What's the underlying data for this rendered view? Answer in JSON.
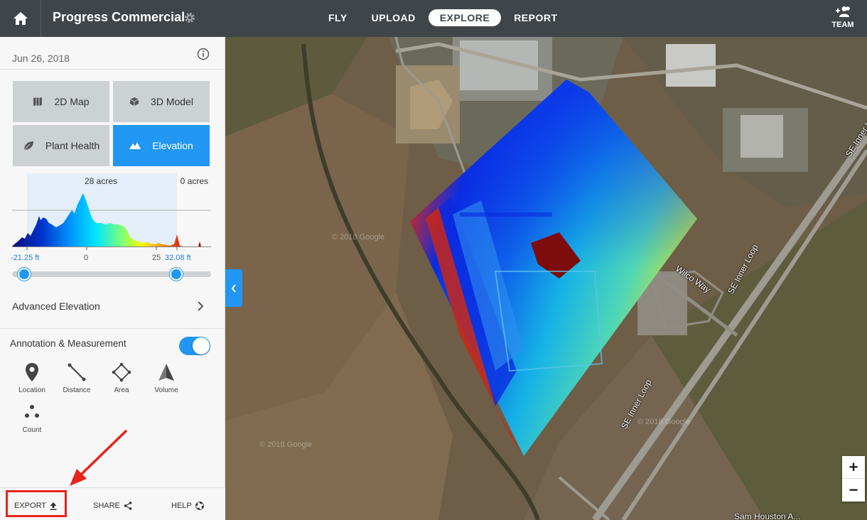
{
  "header": {
    "project_title": "Progress Commercial",
    "nav": [
      {
        "label": "FLY",
        "active": false
      },
      {
        "label": "UPLOAD",
        "active": false
      },
      {
        "label": "EXPLORE",
        "active": true
      },
      {
        "label": "REPORT",
        "active": false
      }
    ],
    "team_label": "TEAM"
  },
  "sidebar": {
    "date": "Jun 26, 2018",
    "layers": [
      {
        "label": "2D Map",
        "icon": "map-icon",
        "active": false
      },
      {
        "label": "3D Model",
        "icon": "cube-icon",
        "active": false
      },
      {
        "label": "Plant Health",
        "icon": "leaf-icon",
        "active": false
      },
      {
        "label": "Elevation",
        "icon": "mountain-icon",
        "active": true
      }
    ],
    "histogram": {
      "left_acres": "28 acres",
      "right_acres": "0 acres",
      "min_label": "-21.25 ft",
      "zero_label": "0",
      "mid_label": "25",
      "max_label": "32.08 ft",
      "range_low_ft": -21.25,
      "range_high_ft": 32.08
    },
    "advanced_elevation_label": "Advanced Elevation",
    "annotation_title": "Annotation & Measurement",
    "annotation_enabled": true,
    "tools": [
      {
        "label": "Location",
        "icon": "location-pin-icon"
      },
      {
        "label": "Distance",
        "icon": "distance-line-icon"
      },
      {
        "label": "Area",
        "icon": "area-polygon-icon"
      },
      {
        "label": "Volume",
        "icon": "volume-icon"
      },
      {
        "label": "Count",
        "icon": "count-dots-icon"
      }
    ],
    "bottom": {
      "export": "EXPORT",
      "share": "SHARE",
      "help": "HELP"
    }
  },
  "map": {
    "roads": [
      "SE Inner Loop",
      "SE Inner Loop",
      "SE Inner Loop",
      "Wilco Way",
      "Sam Houston A..."
    ],
    "watermark": "© 2018 Google",
    "zoom_in": "+",
    "zoom_out": "−"
  },
  "colors": {
    "topbar": "#3f4549",
    "accent": "#2196f3",
    "highlight": "#e8231a"
  }
}
